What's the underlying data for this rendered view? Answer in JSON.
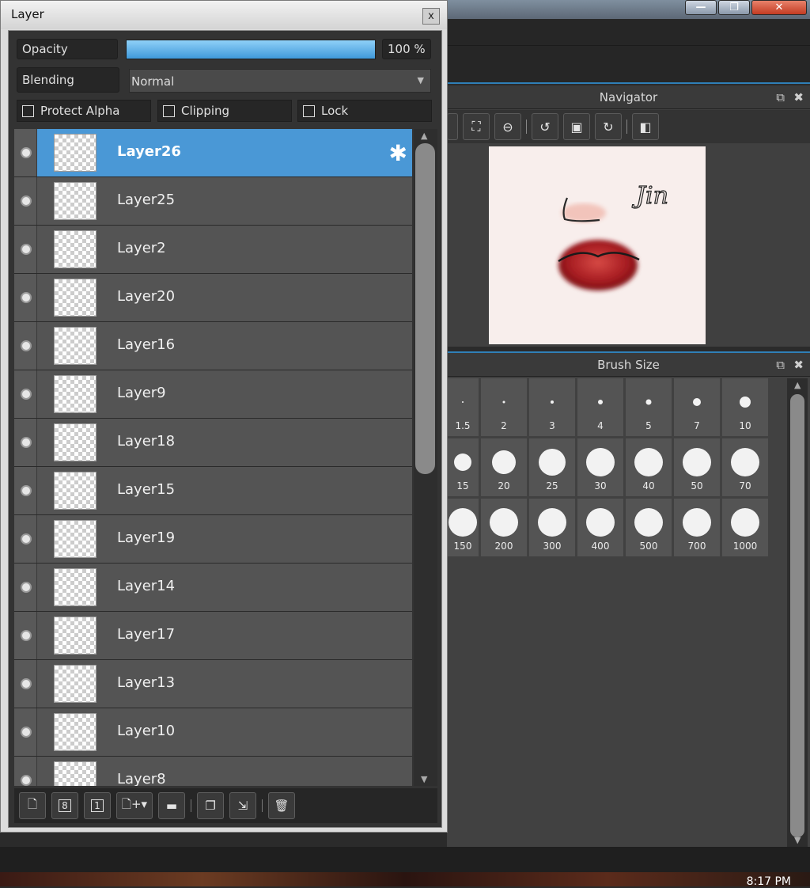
{
  "layer_dialog": {
    "title": "Layer",
    "close": "x",
    "opacity": {
      "label": "Opacity",
      "value_text": "100 %",
      "value": 1.0
    },
    "blending": {
      "label": "Blending",
      "value": "Normal"
    },
    "options": {
      "protect_alpha": "Protect Alpha",
      "clipping": "Clipping",
      "lock": "Lock"
    },
    "layers": [
      {
        "name": "Layer26",
        "selected": true
      },
      {
        "name": "Layer25"
      },
      {
        "name": "Layer2"
      },
      {
        "name": "Layer20"
      },
      {
        "name": "Layer16"
      },
      {
        "name": "Layer9"
      },
      {
        "name": "Layer18"
      },
      {
        "name": "Layer15"
      },
      {
        "name": "Layer19"
      },
      {
        "name": "Layer14"
      },
      {
        "name": "Layer17"
      },
      {
        "name": "Layer13"
      },
      {
        "name": "Layer10"
      },
      {
        "name": "Layer8"
      }
    ],
    "toolbar": [
      "new-layer-icon",
      "new-8bit-layer-icon",
      "new-1bit-layer-icon",
      "add-layer-dropdown-icon",
      "folder-icon",
      "duplicate-icon",
      "merge-icon",
      "trash-icon"
    ]
  },
  "navigator": {
    "title": "Navigator",
    "canvas_text": "Jin"
  },
  "brush_size": {
    "title": "Brush Size",
    "sizes": [
      "1.5",
      "2",
      "3",
      "4",
      "5",
      "7",
      "10",
      "15",
      "20",
      "25",
      "30",
      "40",
      "50",
      "70",
      "150",
      "200",
      "300",
      "400",
      "500",
      "700",
      "1000"
    ]
  },
  "window_controls": {
    "minimize": "—",
    "maximize": "❐",
    "close": "✕"
  },
  "clock": "8:17 PM",
  "colors": {
    "accent": "#4a98d6",
    "panel": "#414141"
  }
}
